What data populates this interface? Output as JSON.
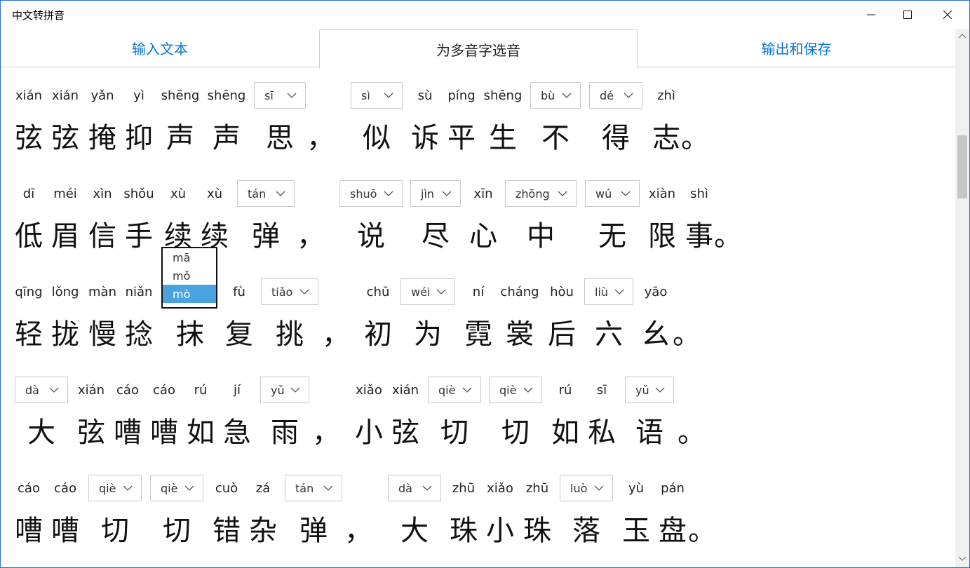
{
  "window": {
    "title": "中文转拼音"
  },
  "tabs": [
    {
      "label": "输入文本",
      "state": "link"
    },
    {
      "label": "为多音字选音",
      "state": "active"
    },
    {
      "label": "输出和保存",
      "state": "link"
    }
  ],
  "lines": [
    {
      "cells": [
        {
          "py": "xián",
          "hz": "弦"
        },
        {
          "py": "xián",
          "hz": "弦"
        },
        {
          "py": "yǎn",
          "hz": "掩"
        },
        {
          "py": "yì",
          "hz": "抑"
        },
        {
          "py": "shēng",
          "hz": "声"
        },
        {
          "py": "shēng",
          "hz": "声"
        },
        {
          "dd": "sī",
          "hz": "思"
        },
        {
          "py": "",
          "hz": "，"
        },
        {
          "dd": "sì",
          "hz": "似"
        },
        {
          "py": "sù",
          "hz": "诉"
        },
        {
          "py": "píng",
          "hz": "平"
        },
        {
          "py": "shēng",
          "hz": "生"
        },
        {
          "dd": "bù",
          "hz": "不"
        },
        {
          "dd": "dé",
          "hz": "得"
        },
        {
          "py": "zhì",
          "hz": "志"
        },
        {
          "py": "",
          "hz": "。"
        }
      ]
    },
    {
      "cells": [
        {
          "py": "dī",
          "hz": "低"
        },
        {
          "py": "méi",
          "hz": "眉"
        },
        {
          "py": "xìn",
          "hz": "信"
        },
        {
          "py": "shǒu",
          "hz": "手"
        },
        {
          "py": "xù",
          "hz": "续"
        },
        {
          "py": "xù",
          "hz": "续"
        },
        {
          "dd": "tán",
          "hz": "弹"
        },
        {
          "py": "",
          "hz": "，"
        },
        {
          "dd": "shuō",
          "hz": "说"
        },
        {
          "dd": "jìn",
          "hz": "尽"
        },
        {
          "py": "xīn",
          "hz": "心"
        },
        {
          "dd": "zhōng",
          "hz": "中"
        },
        {
          "dd": "wú",
          "hz": "无"
        },
        {
          "py": "xiàn",
          "hz": "限"
        },
        {
          "py": "shì",
          "hz": "事"
        },
        {
          "py": "",
          "hz": "。"
        }
      ]
    },
    {
      "cells": [
        {
          "py": "qīng",
          "hz": "轻"
        },
        {
          "py": "lǒng",
          "hz": "拢"
        },
        {
          "py": "màn",
          "hz": "慢"
        },
        {
          "py": "niǎn",
          "hz": "捻"
        },
        {
          "dd": "mò",
          "hz": "抹",
          "open": true
        },
        {
          "py": "fù",
          "hz": "复"
        },
        {
          "dd": "tiǎo",
          "hz": "挑"
        },
        {
          "py": "",
          "hz": "，"
        },
        {
          "py": "chū",
          "hz": "初"
        },
        {
          "dd": "wéi",
          "hz": "为"
        },
        {
          "py": "ní",
          "hz": "霓"
        },
        {
          "py": "cháng",
          "hz": "裳"
        },
        {
          "py": "hòu",
          "hz": "后"
        },
        {
          "dd": "liù",
          "hz": "六"
        },
        {
          "py": "yāo",
          "hz": "幺"
        },
        {
          "py": "",
          "hz": "。"
        }
      ]
    },
    {
      "cells": [
        {
          "dd": "dà",
          "hz": "大"
        },
        {
          "py": "xián",
          "hz": "弦"
        },
        {
          "py": "cáo",
          "hz": "嘈"
        },
        {
          "py": "cáo",
          "hz": "嘈"
        },
        {
          "py": "rú",
          "hz": "如"
        },
        {
          "py": "jí",
          "hz": "急"
        },
        {
          "dd": "yǔ",
          "hz": "雨"
        },
        {
          "py": "",
          "hz": "，"
        },
        {
          "py": "xiǎo",
          "hz": "小"
        },
        {
          "py": "xián",
          "hz": "弦"
        },
        {
          "dd": "qiè",
          "hz": "切"
        },
        {
          "dd": "qiè",
          "hz": "切"
        },
        {
          "py": "rú",
          "hz": "如"
        },
        {
          "py": "sī",
          "hz": "私"
        },
        {
          "dd": "yǔ",
          "hz": "语"
        },
        {
          "py": "",
          "hz": "。"
        }
      ]
    },
    {
      "cells": [
        {
          "py": "cáo",
          "hz": "嘈"
        },
        {
          "py": "cáo",
          "hz": "嘈"
        },
        {
          "dd": "qiè",
          "hz": "切"
        },
        {
          "dd": "qiè",
          "hz": "切"
        },
        {
          "py": "cuò",
          "hz": "错"
        },
        {
          "py": "zá",
          "hz": "杂"
        },
        {
          "dd": "tán",
          "hz": "弹"
        },
        {
          "py": "",
          "hz": "，"
        },
        {
          "dd": "dà",
          "hz": "大"
        },
        {
          "py": "zhū",
          "hz": "珠"
        },
        {
          "py": "xiǎo",
          "hz": "小"
        },
        {
          "py": "zhū",
          "hz": "珠"
        },
        {
          "dd": "luò",
          "hz": "落"
        },
        {
          "py": "yù",
          "hz": "玉"
        },
        {
          "py": "pán",
          "hz": "盘"
        },
        {
          "py": "",
          "hz": "。"
        }
      ]
    }
  ],
  "popup": {
    "options": [
      "mā",
      "mǒ",
      "mò"
    ],
    "selected": "mò"
  }
}
